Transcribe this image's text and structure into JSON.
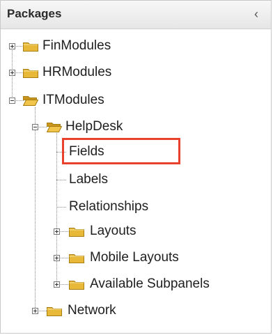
{
  "panel": {
    "title": "Packages",
    "collapse_icon": "chevron-left-icon",
    "highlight_color": "#e8422f"
  },
  "tree": [
    {
      "label": "FinModules",
      "type": "folder",
      "state": "collapsed"
    },
    {
      "label": "HRModules",
      "type": "folder",
      "state": "collapsed"
    },
    {
      "label": "ITModules",
      "type": "folder",
      "state": "expanded"
    },
    {
      "label": "HelpDesk",
      "type": "folder",
      "state": "expanded"
    },
    {
      "label": "Fields",
      "type": "leaf",
      "selected": true
    },
    {
      "label": "Labels",
      "type": "leaf"
    },
    {
      "label": "Relationships",
      "type": "leaf"
    },
    {
      "label": "Layouts",
      "type": "folder",
      "state": "collapsed"
    },
    {
      "label": "Mobile Layouts",
      "type": "folder",
      "state": "collapsed"
    },
    {
      "label": "Available Subpanels",
      "type": "folder",
      "state": "collapsed"
    },
    {
      "label": "Network",
      "type": "folder",
      "state": "collapsed"
    }
  ]
}
